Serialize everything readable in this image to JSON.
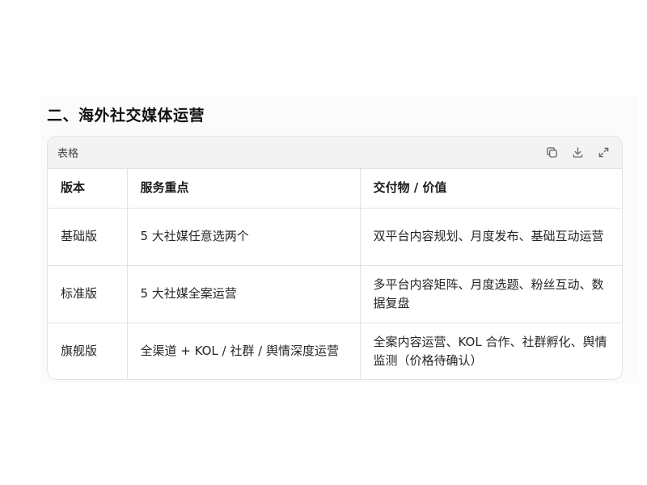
{
  "section": {
    "title": "二、海外社交媒体运营"
  },
  "table_card": {
    "header_label": "表格",
    "tools": [
      {
        "icon": "copy-icon"
      },
      {
        "icon": "download-icon"
      },
      {
        "icon": "expand-icon"
      }
    ],
    "columns": [
      "版本",
      "服务重点",
      "交付物 / 价值"
    ],
    "rows": [
      [
        "基础版",
        "5 大社媒任意选两个",
        "双平台内容规划、月度发布、基础互动运营"
      ],
      [
        "标准版",
        "5 大社媒全案运营",
        "多平台内容矩阵、月度选题、粉丝互动、数据复盘"
      ],
      [
        "旗舰版",
        "全渠道 + KOL / 社群 / 舆情深度运营",
        "全案内容运营、KOL 合作、社群孵化、舆情监测（价格待确认）"
      ]
    ]
  },
  "colors": {
    "header_bg": "#f3f3f3",
    "border": "#e3e3e3",
    "text": "#1f1f1f"
  }
}
